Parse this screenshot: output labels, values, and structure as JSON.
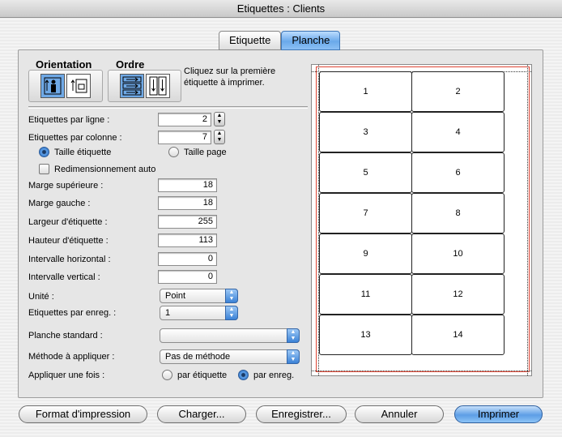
{
  "window": {
    "title": "Etiquettes : Clients"
  },
  "tabs": [
    {
      "label": "Etiquette",
      "active": false
    },
    {
      "label": "Planche",
      "active": true
    }
  ],
  "orientation": {
    "title": "Orientation",
    "options": [
      "portrait-icon",
      "landscape-icon"
    ],
    "selected": 0
  },
  "ordre": {
    "title": "Ordre",
    "options": [
      "order-rows-icon",
      "order-columns-icon"
    ],
    "selected": 0
  },
  "hint": "Cliquez sur la première étiquette à imprimer.",
  "fields": {
    "par_ligne": {
      "label": "Etiquettes par ligne :",
      "value": "2"
    },
    "par_colonne": {
      "label": "Etiquettes par colonne :",
      "value": "7"
    },
    "taille_etiquette": "Taille étiquette",
    "taille_page": "Taille page",
    "redim": "Redimensionnement auto",
    "marge_sup": {
      "label": "Marge supérieure :",
      "value": "18"
    },
    "marge_gauche": {
      "label": "Marge gauche :",
      "value": "18"
    },
    "largeur": {
      "label": "Largeur d'étiquette :",
      "value": "255"
    },
    "hauteur": {
      "label": "Hauteur d'étiquette :",
      "value": "113"
    },
    "int_h": {
      "label": "Intervalle horizontal :",
      "value": "0"
    },
    "int_v": {
      "label": "Intervalle vertical :",
      "value": "0"
    },
    "unite": {
      "label": "Unité :",
      "value": "Point"
    },
    "par_enreg": {
      "label": "Etiquettes par enreg. :",
      "value": "1"
    },
    "planche": {
      "label": "Planche standard :",
      "value": ""
    },
    "methode": {
      "label": "Méthode à appliquer :",
      "value": "Pas de méthode"
    },
    "appliquer": {
      "label": "Appliquer une fois :",
      "opt1": "par étiquette",
      "opt2": "par enreg.",
      "selected": "opt2"
    }
  },
  "labels": [
    "1",
    "2",
    "3",
    "4",
    "5",
    "6",
    "7",
    "8",
    "9",
    "10",
    "11",
    "12",
    "13",
    "14"
  ],
  "buttons": {
    "format": "Format d'impression",
    "charger": "Charger...",
    "enregistrer": "Enregistrer...",
    "annuler": "Annuler",
    "imprimer": "Imprimer"
  },
  "colors": {
    "accent": "#5d9ee6",
    "margin_line": "#dd4433"
  }
}
